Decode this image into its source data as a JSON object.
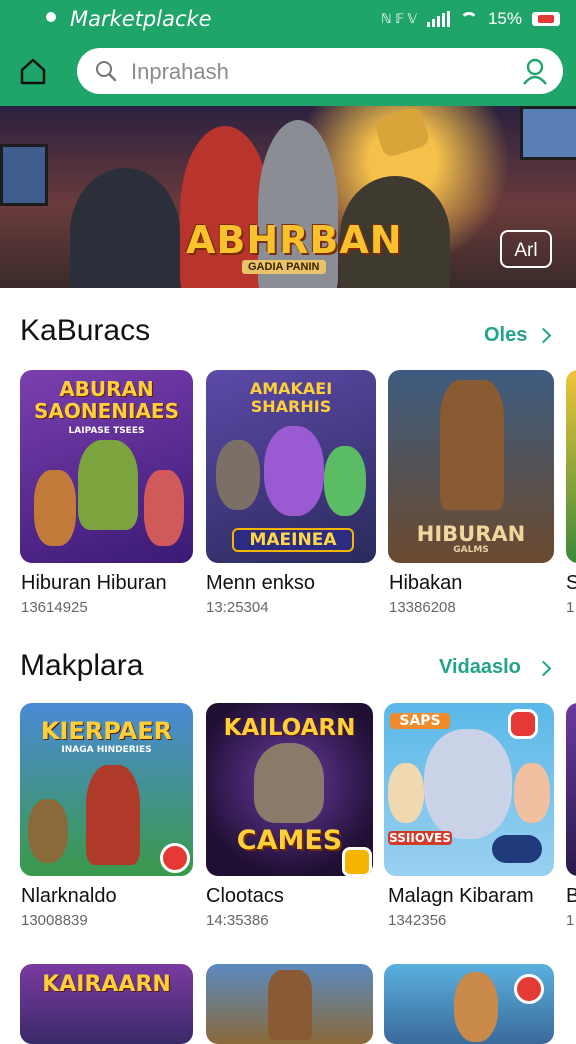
{
  "status_bar": {
    "app_title": "Marketplacke",
    "indicators": "ℕ 𝔽 𝕍",
    "battery_text": "15%"
  },
  "search": {
    "placeholder": "Inprahash"
  },
  "hero": {
    "title": "ABHRBAN",
    "subtitle": "GADIA PANIN",
    "badge": "Arl"
  },
  "section1": {
    "title": "KaBuracs",
    "link": "Oles",
    "items": [
      {
        "name": "Hiburan Hiburan",
        "count": "13614925",
        "art_title": "ABURAN SAONENIAES",
        "art_sub": "LAIPASE TSEES"
      },
      {
        "name": "Menn enkso",
        "count": "13:25304",
        "art_title": "AMAKAEI SHARHIS",
        "art_sub": "MAEINEA"
      },
      {
        "name": "Hibakan",
        "count": "13386208",
        "art_title": "HIBURAN",
        "art_sub": "GALMS"
      },
      {
        "name": "S",
        "count": "1"
      }
    ]
  },
  "section2": {
    "title": "Makplara",
    "link": "Vidaaslo",
    "items": [
      {
        "name": "Nlarknaldo",
        "count": "13008839",
        "art_title": "KIERPAER",
        "art_sub": "INAGA HINDERIES"
      },
      {
        "name": "Clootacs",
        "count": "14:35386",
        "art_title": "KAILOARN",
        "art_sub": "CAMES"
      },
      {
        "name": "Malagn Kibaram",
        "count": "1342356",
        "art_title": "SAPS",
        "art_sub": "SSIIOVES"
      },
      {
        "name": "B",
        "count": "1"
      }
    ]
  },
  "section3": {
    "items": [
      {
        "art_title": "KAIRAARN"
      }
    ]
  },
  "colors": {
    "brand": "#1fa56a",
    "accent": "#23a389"
  }
}
